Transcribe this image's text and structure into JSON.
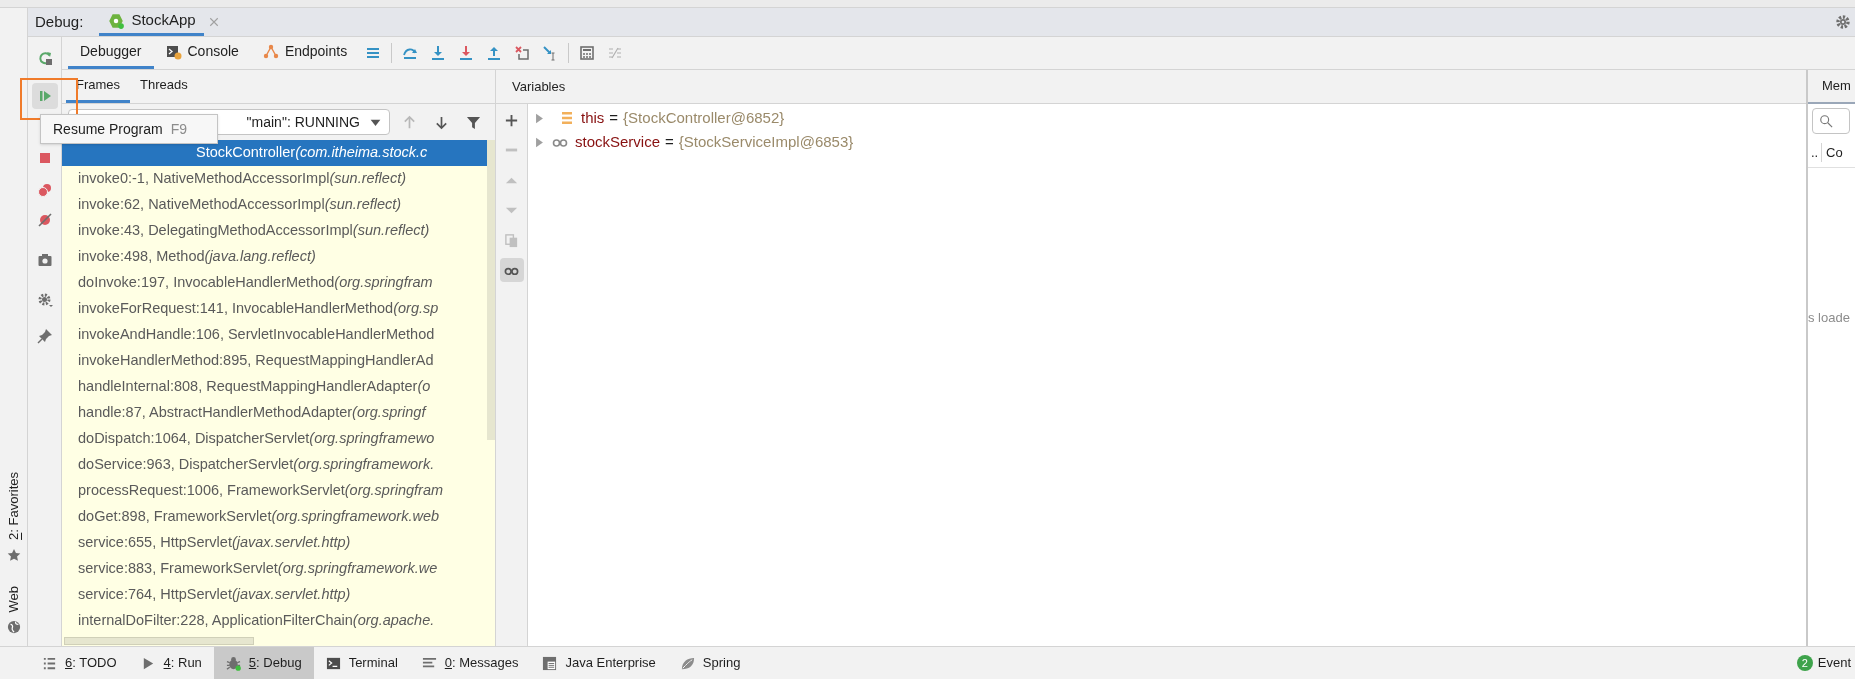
{
  "window": {
    "label": "Debug:",
    "session_tab": {
      "title": "StockApp",
      "selected": true
    }
  },
  "side_strip": [
    {
      "kind": "favorites",
      "mnemonic": "2",
      "label": ": Favorites"
    },
    {
      "kind": "web",
      "label": "Web"
    }
  ],
  "actions": [
    {
      "kind": "rerun",
      "highlighted": false
    },
    {
      "kind": "resume",
      "highlighted": true
    },
    {
      "kind": "stop",
      "highlighted": false
    },
    {
      "kind": "breakpoints",
      "highlighted": false
    },
    {
      "kind": "mute",
      "highlighted": false
    },
    {
      "kind": "camera",
      "highlighted": false
    },
    {
      "kind": "settings",
      "highlighted": false
    },
    {
      "kind": "pin",
      "highlighted": false
    }
  ],
  "tooltip": {
    "text": "Resume Program",
    "shortcut": "F9"
  },
  "toolbar": {
    "tabs": [
      {
        "kind": "debugger",
        "label": "Debugger",
        "selected": true
      },
      {
        "kind": "console",
        "label": "Console",
        "selected": false
      },
      {
        "kind": "endpoints",
        "label": "Endpoints",
        "selected": false
      }
    ],
    "buttons": [
      {
        "kind": "layout"
      },
      {
        "kind": "step-over"
      },
      {
        "kind": "step-into"
      },
      {
        "kind": "force-step-into"
      },
      {
        "kind": "step-out"
      },
      {
        "kind": "drop-frame"
      },
      {
        "kind": "run-to-cursor"
      },
      {
        "kind": "evaluate"
      },
      {
        "kind": "trace"
      }
    ]
  },
  "frames_panel": {
    "tabs": [
      {
        "label": "Frames",
        "selected": true
      },
      {
        "label": "Threads",
        "selected": false
      }
    ],
    "thread": "\"main\": RUNNING",
    "frames": [
      {
        "location": "StockController",
        "package": "(com.itheima.stock.c",
        "selected": true,
        "partly_hidden": true
      },
      {
        "location": "invoke0:-1, NativeMethodAccessorImpl",
        "package": "(sun.reflect)",
        "selected": false
      },
      {
        "location": "invoke:62, NativeMethodAccessorImpl",
        "package": "(sun.reflect)",
        "selected": false
      },
      {
        "location": "invoke:43, DelegatingMethodAccessorImpl",
        "package": "(sun.reflect)",
        "selected": false
      },
      {
        "location": "invoke:498, Method",
        "package": "(java.lang.reflect)",
        "selected": false
      },
      {
        "location": "doInvoke:197, InvocableHandlerMethod",
        "package": "(org.springfram",
        "selected": false
      },
      {
        "location": "invokeForRequest:141, InvocableHandlerMethod",
        "package": "(org.sp",
        "selected": false
      },
      {
        "location": "invokeAndHandle:106, ServletInvocableHandlerMethod",
        "selected": false
      },
      {
        "location": "invokeHandlerMethod:895, RequestMappingHandlerAd",
        "selected": false
      },
      {
        "location": "handleInternal:808, RequestMappingHandlerAdapter",
        "package": "(o",
        "selected": false
      },
      {
        "location": "handle:87, AbstractHandlerMethodAdapter",
        "package": "(org.springf",
        "selected": false
      },
      {
        "location": "doDispatch:1064, DispatcherServlet",
        "package": "(org.springframewo",
        "selected": false
      },
      {
        "location": "doService:963, DispatcherServlet",
        "package": "(org.springframework.",
        "selected": false
      },
      {
        "location": "processRequest:1006, FrameworkServlet",
        "package": "(org.springfram",
        "selected": false
      },
      {
        "location": "doGet:898, FrameworkServlet",
        "package": "(org.springframework.web",
        "selected": false
      },
      {
        "location": "service:655, HttpServlet",
        "package": "(javax.servlet.http)",
        "selected": false
      },
      {
        "location": "service:883, FrameworkServlet",
        "package": "(org.springframework.we",
        "selected": false
      },
      {
        "location": "service:764, HttpServlet",
        "package": "(javax.servlet.http)",
        "selected": false
      },
      {
        "location": "internalDoFilter:228, ApplicationFilterChain",
        "package": "(org.apache.",
        "selected": false
      }
    ]
  },
  "variables": {
    "title": "Variables",
    "items": [
      {
        "kind": "field",
        "name": "this",
        "operator": "=",
        "value": "{StockController@6852}"
      },
      {
        "kind": "watch",
        "name": "stockService",
        "operator": "=",
        "value": "{StockServiceImpl@6853}"
      }
    ]
  },
  "memory": {
    "tab": "Mem",
    "column_1": "..",
    "column_2": "Co",
    "status": "s loade"
  },
  "bottom_bar": {
    "tools": [
      {
        "kind": "todo",
        "mnemonic": "6",
        "label": ": TODO",
        "selected": false
      },
      {
        "kind": "run",
        "mnemonic": "4",
        "label": ": Run",
        "selected": false
      },
      {
        "kind": "debug",
        "mnemonic": "5",
        "label": ": Debug",
        "selected": true
      },
      {
        "kind": "terminal",
        "label": "Terminal",
        "selected": false
      },
      {
        "kind": "messages",
        "mnemonic": "0",
        "label": ": Messages",
        "selected": false
      },
      {
        "kind": "javaee",
        "label": "Java Enterprise",
        "selected": false
      },
      {
        "kind": "spring",
        "label": "Spring",
        "selected": false
      }
    ],
    "event_log": {
      "count": "2",
      "label": "Event"
    }
  }
}
